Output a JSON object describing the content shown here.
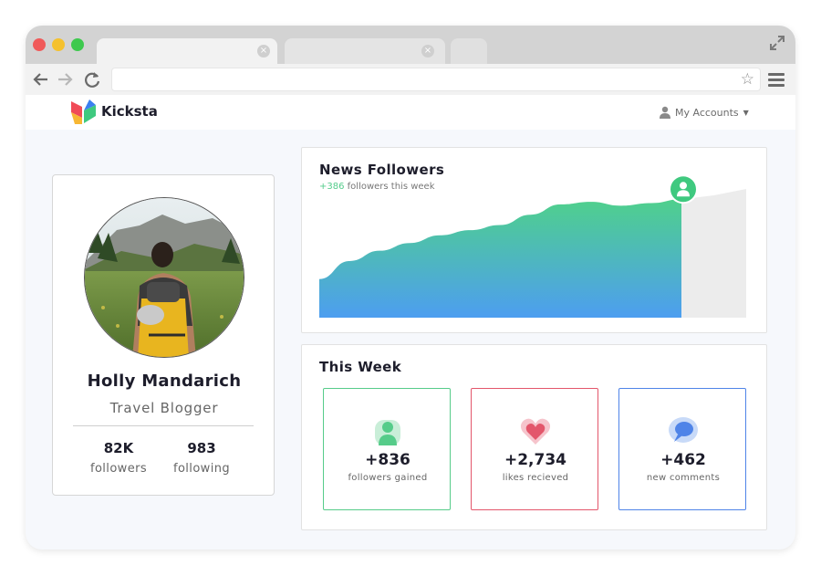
{
  "browser": {
    "traffic_lights": [
      "#f05a5a",
      "#f5c12e",
      "#3ec94e"
    ],
    "tab_close_glyph": "×",
    "nav": {
      "back": "back-arrow-icon",
      "forward": "forward-arrow-icon",
      "reload": "reload-icon"
    },
    "bookmark_icon": "star-icon",
    "menu_icon": "hamburger-icon",
    "expand_icon": "expand-icon"
  },
  "header": {
    "brand": "Kicksta",
    "accounts_label": "My Accounts",
    "logo_colors": [
      "#f04b57",
      "#f7b733",
      "#3fc97f",
      "#3b7ff0"
    ]
  },
  "profile": {
    "name": "Holly Mandarich",
    "role": "Travel Blogger",
    "stats": [
      {
        "value": "82K",
        "label": "followers"
      },
      {
        "value": "983",
        "label": "following"
      }
    ]
  },
  "news_followers": {
    "title": "News Followers",
    "delta": "+386",
    "subtitle_rest": " followers this week",
    "colors": {
      "gradient_top": "#4fd08c",
      "gradient_bottom": "#4d9ef0",
      "projection": "#ececec",
      "marker": "#3fc97f"
    }
  },
  "chart_data": {
    "type": "area",
    "title": "News Followers",
    "series": [
      {
        "values": [
          0.3,
          0.44,
          0.52,
          0.58,
          0.64,
          0.68,
          0.72,
          0.8,
          0.88,
          0.9,
          0.87,
          0.89,
          0.92
        ]
      }
    ],
    "projection": [
      0.95,
      1.0
    ],
    "ylim": [
      0,
      1
    ],
    "grid": false,
    "legend": "none"
  },
  "this_week": {
    "title": "This Week",
    "metrics": [
      {
        "value": "+836",
        "label": "followers gained",
        "icon": "user-icon",
        "color": "#56cc8a"
      },
      {
        "value": "+2,734",
        "label": "likes recieved",
        "icon": "heart-icon",
        "color": "#e3566b"
      },
      {
        "value": "+462",
        "label": "new comments",
        "icon": "comment-icon",
        "color": "#4f84e8"
      }
    ]
  }
}
